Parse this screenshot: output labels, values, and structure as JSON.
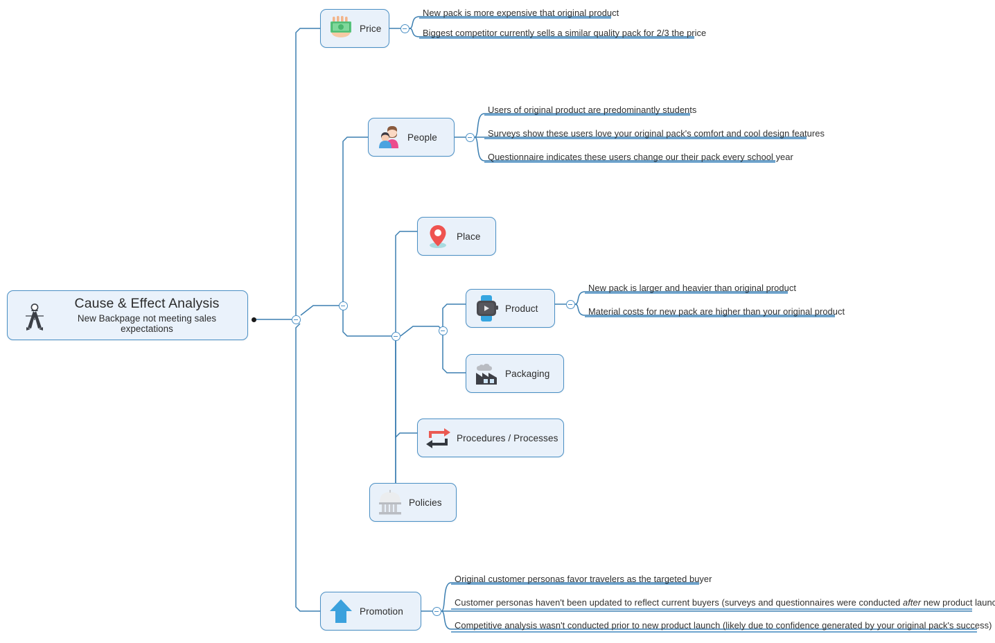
{
  "root": {
    "title": "Cause & Effect Analysis",
    "subtitle": "New Backpage not meeting sales expectations",
    "icon": "compass-divider-icon"
  },
  "branches": [
    {
      "id": "price",
      "label": "Price",
      "icon": "money-in-hand-icon",
      "details": [
        "New pack is more expensive that original product",
        "Biggest competitor currently sells a similar quality pack for 2/3 the price"
      ]
    },
    {
      "id": "people",
      "label": "People",
      "icon": "family-people-icon",
      "details": [
        "Users of original product are predominantly students",
        "Surveys show these users love your original pack's comfort and cool design features",
        "Questionnaire indicates these users change our their pack every school year"
      ]
    },
    {
      "id": "place",
      "label": "Place",
      "icon": "map-pin-icon",
      "details": []
    },
    {
      "id": "product",
      "label": "Product",
      "icon": "smart-watch-icon",
      "details": [
        "New pack is larger and heavier than original product",
        "Material costs for new pack are higher than your original product"
      ]
    },
    {
      "id": "packaging",
      "label": "Packaging",
      "icon": "factory-icon",
      "details": []
    },
    {
      "id": "procedures",
      "label": "Procedures / Processes",
      "icon": "process-arrows-icon",
      "details": []
    },
    {
      "id": "policies",
      "label": "Policies",
      "icon": "classical-building-icon",
      "details": []
    },
    {
      "id": "promotion",
      "label": "Promotion",
      "icon": "up-arrow-icon",
      "details": [
        "Original customer personas favor travelers as the targeted buyer",
        "Customer personas haven't been updated to reflect current buyers (surveys and questionnaires were conducted after new product launch)",
        "Competitive analysis wasn't conducted prior to new product launch (likely due to confidence generated by your original pack's success)"
      ]
    }
  ],
  "colors": {
    "node_fill": "#e9f1fa",
    "node_border": "#4a8fc4",
    "connector": "#3c7fb1",
    "underline": "#3f85bd",
    "text": "#2f2f2f",
    "accent_red": "#e8504a",
    "accent_green": "#5fc77f",
    "accent_blue": "#36a5e0"
  }
}
